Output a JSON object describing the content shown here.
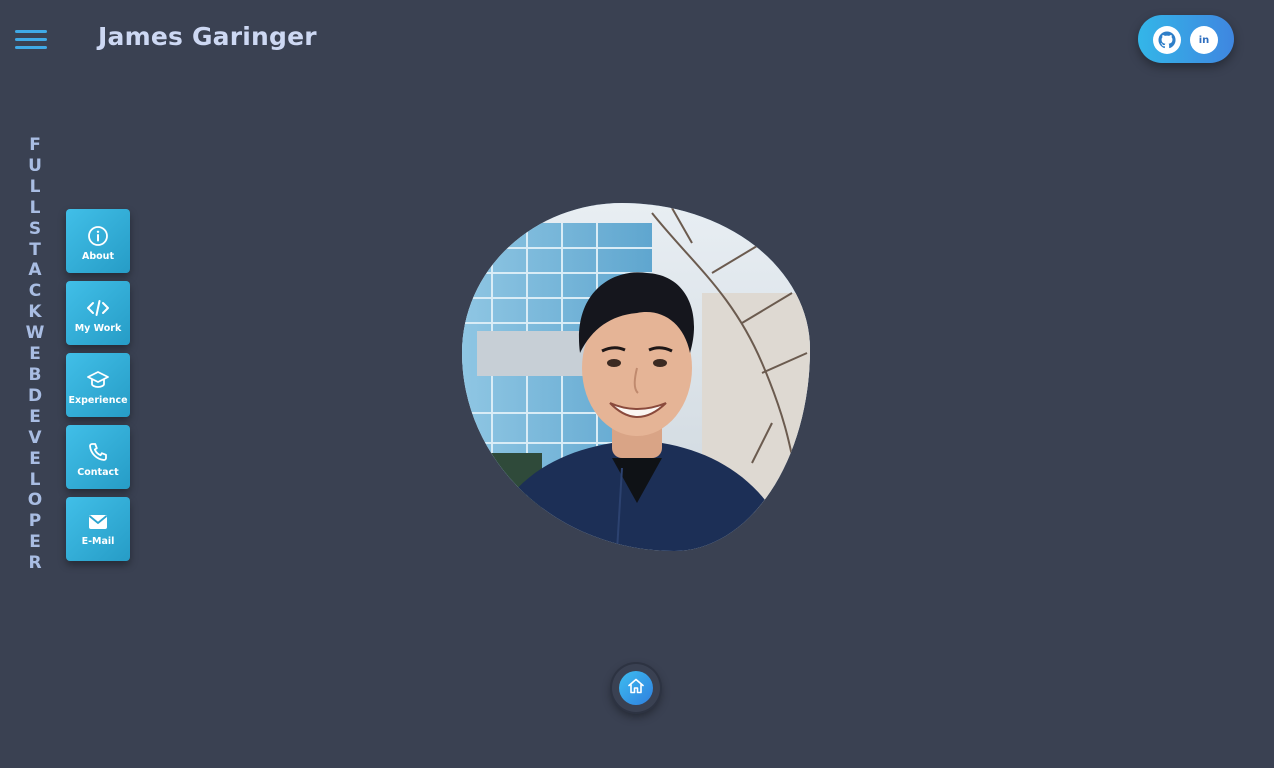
{
  "header": {
    "menu_icon": "hamburger-menu-icon",
    "title": "James Garinger",
    "social": {
      "github_icon": "github-icon",
      "linkedin_icon": "linkedin-icon",
      "linkedin_text": "in",
      "gradient": [
        "#33b6e8",
        "#3f86e0"
      ]
    }
  },
  "tagline": "FULL STACK WEB DEVELOPER",
  "nav": {
    "items": [
      {
        "label": "About",
        "icon": "info-icon"
      },
      {
        "label": "My Work",
        "icon": "code-icon"
      },
      {
        "label": "Experience",
        "icon": "graduation-cap-icon"
      },
      {
        "label": "Contact",
        "icon": "phone-icon"
      },
      {
        "label": "E-Mail",
        "icon": "envelope-icon"
      }
    ]
  },
  "portrait": {
    "description_icon": "profile-photo"
  },
  "home": {
    "icon": "home-icon"
  },
  "colors": {
    "background": "#3a4152",
    "accent": "#3fa9e6",
    "title": "#cdd8f3",
    "tagline": "#a9bde3"
  }
}
